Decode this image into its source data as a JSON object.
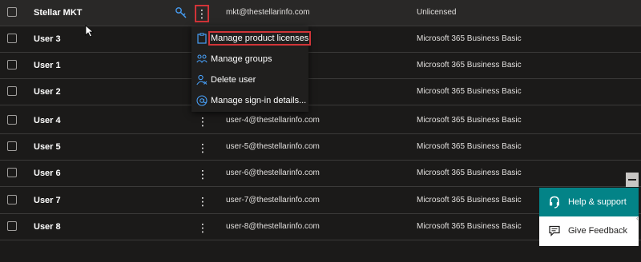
{
  "users": [
    {
      "name": "Stellar MKT",
      "email": "mkt@thestellarinfo.com",
      "license": "Unlicensed"
    },
    {
      "name": "User 3",
      "email": "",
      "license": "Microsoft 365 Business Basic"
    },
    {
      "name": "User 1",
      "email": "",
      "license": "Microsoft 365 Business Basic"
    },
    {
      "name": "User 2",
      "email": "",
      "license": "Microsoft 365 Business Basic"
    },
    {
      "name": "User 4",
      "email": "user-4@thestellarinfo.com",
      "license": "Microsoft 365 Business Basic"
    },
    {
      "name": "User 5",
      "email": "user-5@thestellarinfo.com",
      "license": "Microsoft 365 Business Basic"
    },
    {
      "name": "User 6",
      "email": "user-6@thestellarinfo.com",
      "license": "Microsoft 365 Business Basic"
    },
    {
      "name": "User 7",
      "email": "user-7@thestellarinfo.com",
      "license": "Microsoft 365 Business Basic"
    },
    {
      "name": "User 8",
      "email": "user-8@thestellarinfo.com",
      "license": "Microsoft 365 Business Basic"
    }
  ],
  "more_glyph": "⋮",
  "context_menu": {
    "items": [
      {
        "label": "Manage product licenses",
        "icon": "license-icon"
      },
      {
        "label": "Manage groups",
        "icon": "groups-icon"
      },
      {
        "label": "Delete user",
        "icon": "delete-user-icon"
      },
      {
        "label": "Manage sign-in details...",
        "icon": "at-sign-icon"
      }
    ]
  },
  "help_panel": {
    "help_label": "Help & support",
    "feedback_label": "Give Feedback"
  },
  "colors": {
    "background": "#1b1a19",
    "accent": "#0078d4",
    "highlight_border": "#d13438",
    "help_bg": "#038387"
  }
}
